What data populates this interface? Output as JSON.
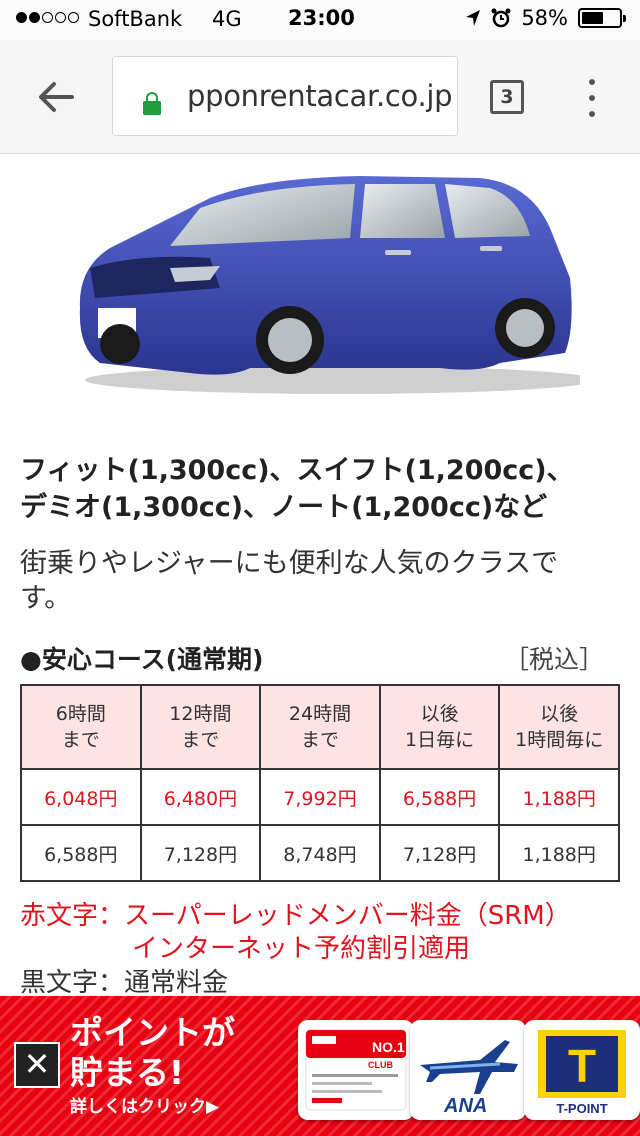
{
  "status": {
    "carrier": "SoftBank",
    "network": "4G",
    "time": "23:00",
    "battery": "58%",
    "battery_level": 0.58
  },
  "browser": {
    "url": "pponrentacar.co.jp",
    "tab_count": "3"
  },
  "car": {
    "title_line1": "フィット(1,300cc)、スイフト(1,200cc)、",
    "title_line2": "デミオ(1,300cc)、ノート(1,200cc)など",
    "desc_line1": "街乗りやレジャーにも便利な人気のクラスで",
    "desc_line2": "す。"
  },
  "course": {
    "title": "●安心コース(通常期)",
    "tax": "［税込］"
  },
  "table": {
    "headers": [
      [
        "6時間",
        "まで"
      ],
      [
        "12時間",
        "まで"
      ],
      [
        "24時間",
        "まで"
      ],
      [
        "以後",
        "1日毎に"
      ],
      [
        "以後",
        "1時間毎に"
      ]
    ],
    "red_row": [
      "6,048円",
      "6,480円",
      "7,992円",
      "6,588円",
      "1,188円"
    ],
    "black_row": [
      "6,588円",
      "7,128円",
      "8,748円",
      "7,128円",
      "1,188円"
    ]
  },
  "notes": {
    "red_line1": "赤文字：スーパーレッドメンバー料金（SRM）",
    "red_line2": "インターネット予約割引適用",
    "black_line": "黒文字：通常料金"
  },
  "banner": {
    "line1": "ポイントが",
    "line2": "貯まる!",
    "link": "詳しくはクリック▶",
    "card1_no": "NO.1",
    "card1_club": "CLUB",
    "card2_label": "ANA",
    "card3_letter": "T",
    "card3_label": "T-POINT"
  },
  "colors": {
    "red_text": "#e0141e",
    "header_bg": "#fde3e6",
    "banner_red": "#e60012",
    "lock_green": "#1f9e3e"
  }
}
